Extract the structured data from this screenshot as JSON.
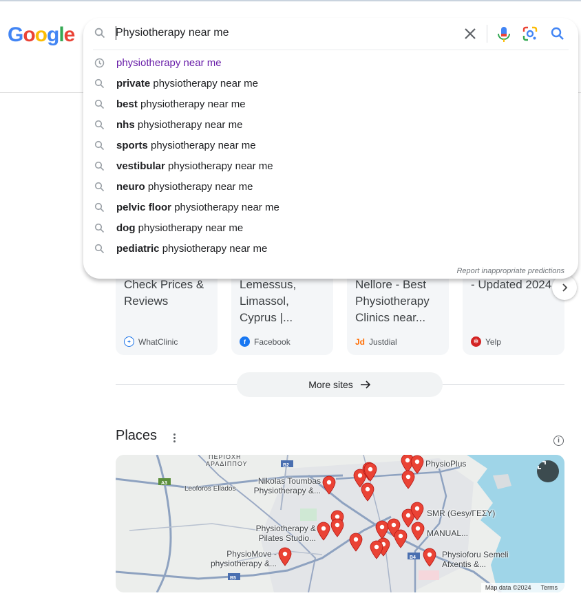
{
  "logo": {
    "letters": [
      "G",
      "o",
      "o",
      "g",
      "l",
      "e"
    ],
    "colors": [
      "#4285F4",
      "#EA4335",
      "#FBBC05",
      "#4285F4",
      "#34A853",
      "#EA4335"
    ]
  },
  "search": {
    "query": "Physiotherapy near me",
    "suggestions": [
      {
        "type": "history",
        "bold": "",
        "text": "physiotherapy near me"
      },
      {
        "type": "search",
        "bold": "private",
        "text": " physiotherapy near me"
      },
      {
        "type": "search",
        "bold": "best",
        "text": " physiotherapy near me"
      },
      {
        "type": "search",
        "bold": "nhs",
        "text": " physiotherapy near me"
      },
      {
        "type": "search",
        "bold": "sports",
        "text": " physiotherapy near me"
      },
      {
        "type": "search",
        "bold": "vestibular",
        "text": " physiotherapy near me"
      },
      {
        "type": "search",
        "bold": "neuro",
        "text": " physiotherapy near me"
      },
      {
        "type": "search",
        "bold": "pelvic floor",
        "text": " physiotherapy near me"
      },
      {
        "type": "search",
        "bold": "dog",
        "text": " physiotherapy near me"
      },
      {
        "type": "search",
        "bold": "pediatric",
        "text": " physiotherapy near me"
      }
    ],
    "report_link": "Report inappropriate predictions"
  },
  "cards": [
    {
      "title": "Check Prices & Reviews",
      "source": "WhatClinic",
      "icon": "whatclinic-icon",
      "icon_color": "#1a73e8"
    },
    {
      "title": "Lemessus, Limassol, Cyprus |...",
      "source": "Facebook",
      "icon": "facebook-icon",
      "icon_color": "#1877f2"
    },
    {
      "title": "Nellore - Best Physiotherapy Clinics near...",
      "source": "Justdial",
      "icon": "justdial-icon",
      "icon_color": "#ff6c00"
    },
    {
      "title": "- Updated 2024",
      "source": "Yelp",
      "icon": "yelp-icon",
      "icon_color": "#d32323"
    }
  ],
  "more_sites": "More sites",
  "places": {
    "title": "Places",
    "map_labels": {
      "periochi": "ΠΕΡΙΟΧΗ",
      "aradippou": "ΑΡΑΔΙΠΠΟΥ",
      "road_a3": "A3",
      "road_b2": "B2",
      "road_b4": "B4",
      "road_b5": "B5",
      "leoforos": "Leoforos Ellados",
      "nikolas": "Nikolas Toumbas Physiotherapy &...",
      "physio_pilates": "Physiotherapy & Pilates Studio...",
      "physiomove": "PhysioMove - physiotherapy &...",
      "physioplus": "PhysioPlus",
      "smr": "SMR (Gesy/ΓΕΣΥ)",
      "manual": "MANUAL...",
      "physioforu": "Physioforu Semeli Afxentis &..."
    },
    "map_data": "Map data ©2024",
    "terms": "Terms"
  },
  "colors": {
    "pin": "#ea4335",
    "history": "#681da8",
    "sea": "#9fd5e8"
  }
}
